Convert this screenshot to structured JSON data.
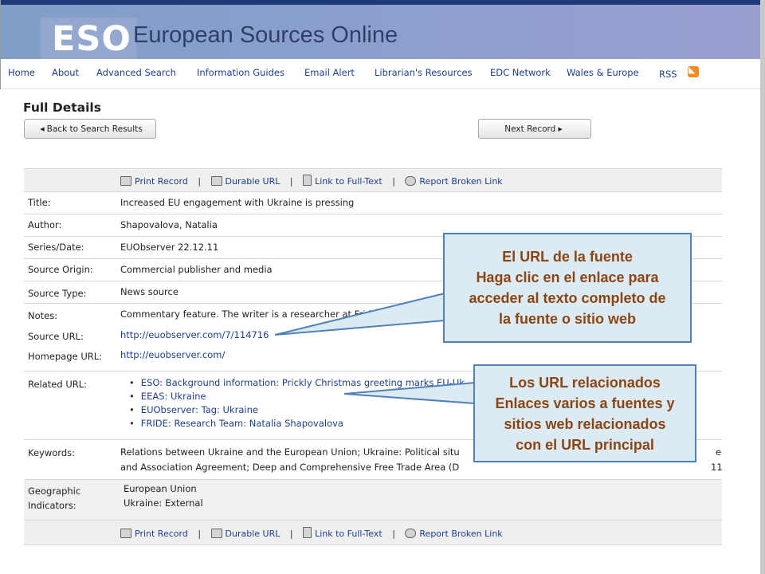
{
  "banner": {
    "logo": "ESO",
    "title": "European Sources Online"
  },
  "nav": {
    "items": [
      "Home",
      "About",
      "Advanced Search",
      "Information Guides",
      "Email Alert",
      "Librarian's Resources",
      "EDC Network",
      "Wales & Europe"
    ],
    "rss": "RSS"
  },
  "page": {
    "heading": "Full Details",
    "back_button": "Back to Search Results",
    "next_button": "Next Record"
  },
  "actions": {
    "print": "Print Record",
    "durable": "Durable URL",
    "fulltext": "Link to Full-Text",
    "report": "Report Broken Link",
    "separator": "|"
  },
  "record": {
    "title_label": "Title:",
    "title": "Increased EU engagement with Ukraine is pressing",
    "author_label": "Author:",
    "author": "Shapovalova, Natalia",
    "series_label": "Series/Date:",
    "series": "EUObserver 22.12.11",
    "origin_label": "Source Origin:",
    "origin": "Commercial publisher and media",
    "type_label": "Source Type:",
    "type": "News source",
    "notes_label": "Notes:",
    "notes": "Commentary feature. The writer is a researcher at Fride",
    "source_url_label": "Source URL:",
    "source_url": "http://euobserver.com/7/114716",
    "homepage_label": "Homepage URL:",
    "homepage": "http://euobserver.com/",
    "related_label": "Related URL:",
    "related": [
      "ESO: Background information: Prickly Christmas greeting marks EU-Uk",
      "EEAS: Ukraine",
      "EUObserver: Tag: Ukraine",
      "FRIDE: Research Team: Natalia Shapovalova"
    ],
    "keywords_label": "Keywords:",
    "keywords_line1": "Relations between Ukraine and the European Union; Ukraine: Political situ",
    "keywords_line1_end": "e",
    "keywords_line2": "and Association Agreement; Deep and Comprehensive Free Trade Area (D",
    "keywords_line2_end": "11",
    "geo_label_1": "Geographic",
    "geo_label_2": "Indicators:",
    "geo": [
      "European Union",
      "Ukraine: External"
    ]
  },
  "callouts": {
    "source": [
      "El URL de la fuente",
      "Haga clic en el enlace para",
      "acceder al texto completo de",
      "la fuente o sitio web"
    ],
    "related": [
      "Los URL relacionados",
      "Enlaces varios a fuentes y",
      "sitios web relacionados",
      "con el URL principal"
    ]
  },
  "colors": {
    "callout_text": "#8b4513",
    "callout_border": "#4f81bd",
    "callout_fill": "#dcebf3",
    "link": "#1c3f8f"
  }
}
